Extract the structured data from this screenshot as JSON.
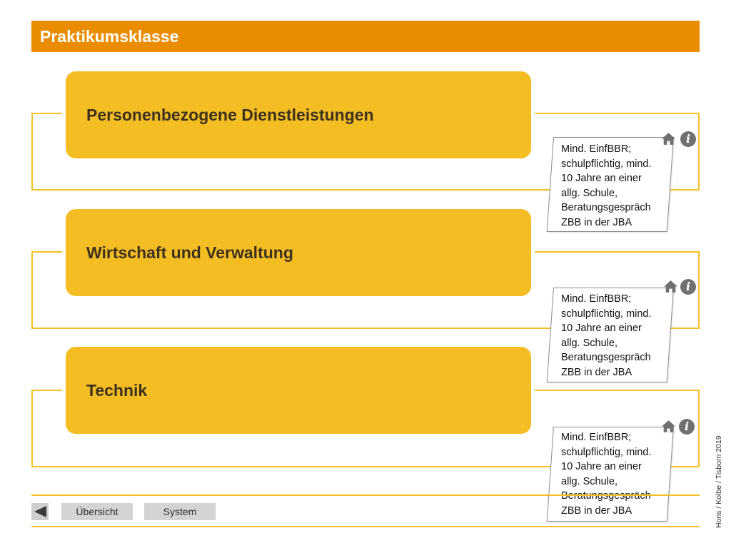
{
  "title": "Praktikumsklasse",
  "categories": [
    {
      "label": "Personenbezogene Dienstleistungen",
      "note": "Mind. EinfBBR;\nschulpflichtig, mind.\n10 Jahre an einer\nallg. Schule,\nBeratungsgespräch\nZBB in der JBA",
      "icons": [
        "home-icon",
        "info-icon"
      ],
      "info_glyph": "i"
    },
    {
      "label": "Wirtschaft und Verwaltung",
      "note": "Mind. EinfBBR;\nschulpflichtig, mind.\n10 Jahre an einer\nallg. Schule,\nBeratungsgespräch\nZBB in der JBA",
      "icons": [
        "home-icon",
        "info-icon"
      ],
      "info_glyph": "i"
    },
    {
      "label": "Technik",
      "note": "Mind. EinfBBR;\nschulpflichtig, mind.\n10 Jahre an einer\nallg. Schule,\nBeratungsgespräch\nZBB in der JBA",
      "icons": [
        "home-icon",
        "info-icon"
      ],
      "info_glyph": "i"
    }
  ],
  "footer": {
    "back_icon": "arrow-left-icon",
    "overview_label": "Übersicht",
    "system_label": "System",
    "credit": "Hons / Kolbe / Tisborn 2019"
  },
  "colors": {
    "title_bar": "#ea8c00",
    "category_fill": "#f4bd23",
    "frame_line": "#f5c025",
    "icon_gray": "#707070",
    "nav_button": "#d4d4d4"
  }
}
